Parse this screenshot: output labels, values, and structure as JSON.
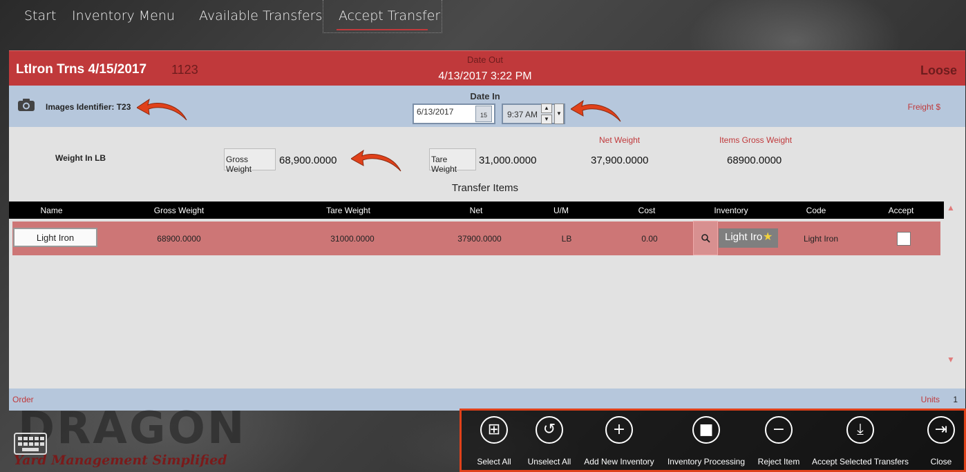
{
  "nav": {
    "items": [
      "Start",
      "Inventory Menu",
      "Available Transfers",
      "Accept Transfer"
    ]
  },
  "header": {
    "title": "LtIron Trns 4/15/2017",
    "number": "1123",
    "date_out_label": "Date Out",
    "date_out_value": "4/13/2017 3:22 PM",
    "status": "Loose"
  },
  "info": {
    "images_identifier": "Images Identifier: T23",
    "date_in_label": "Date In",
    "date_in_value": "6/13/2017",
    "calendar_day": "15",
    "time_value": "9:37 AM",
    "freight_label": "Freight $"
  },
  "weights": {
    "label": "Weight In LB",
    "gross_label": "Gross Weight",
    "gross_value": "68,900.0000",
    "tare_label": "Tare Weight",
    "tare_value": "31,000.0000",
    "net_label": "Net Weight",
    "net_value": "37,900.0000",
    "items_gross_label": "Items Gross Weight",
    "items_gross_value": "68900.0000"
  },
  "grid": {
    "title": "Transfer Items",
    "columns": [
      "Name",
      "Gross Weight",
      "Tare Weight",
      "Net",
      "U/M",
      "Cost",
      "Inventory",
      "Code",
      "Accept"
    ],
    "rows": [
      {
        "name": "Light Iron",
        "gross": "68900.0000",
        "tare": "31000.0000",
        "net": "37900.0000",
        "um": "LB",
        "cost": "0.00",
        "inventory": "Light Iro",
        "code": "Light Iron",
        "accept": false
      }
    ]
  },
  "footer": {
    "order_label": "Order",
    "units_label": "Units",
    "units_value": "1"
  },
  "logo": {
    "name": "DRAGON",
    "tagline": "Yard Management Simplified"
  },
  "commands": [
    {
      "label": "Select All",
      "icon": "select-all-icon"
    },
    {
      "label": "Unselect All",
      "icon": "undo-icon"
    },
    {
      "label": "Add New Inventory",
      "icon": "plus-icon"
    },
    {
      "label": "Inventory Processing",
      "icon": "stop-icon"
    },
    {
      "label": "Reject Item",
      "icon": "minus-icon"
    },
    {
      "label": "Accept Selected Transfers",
      "icon": "download-icon"
    },
    {
      "label": "Close",
      "icon": "exit-icon"
    }
  ],
  "colors": {
    "header_red": "#c0393b",
    "band_blue": "#b6c7dc",
    "row_red": "#cd7676",
    "highlight_orange": "#e0411a"
  }
}
